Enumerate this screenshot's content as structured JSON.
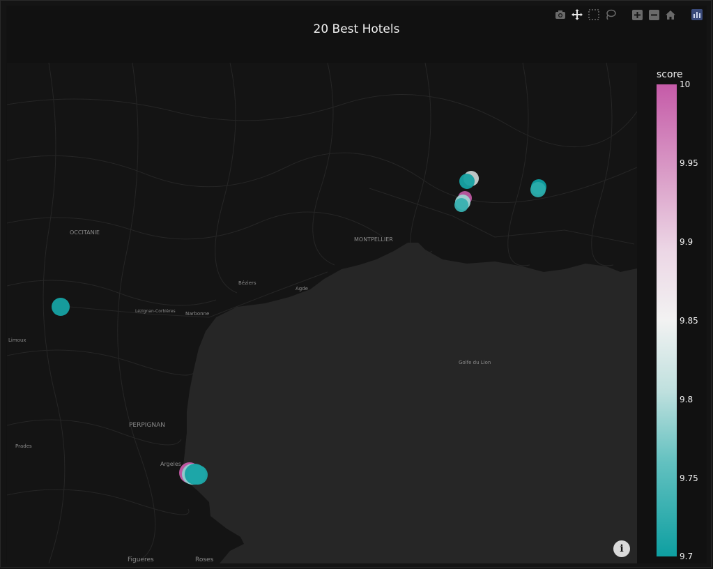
{
  "title": "20 Best Hotels",
  "modebar": [
    {
      "name": "camera-icon",
      "label": "Download plot as a png"
    },
    {
      "name": "pan-icon",
      "label": "Pan"
    },
    {
      "name": "box-select-icon",
      "label": "Box Select"
    },
    {
      "name": "lasso-select-icon",
      "label": "Lasso Select"
    },
    {
      "name": "zoom-in-icon",
      "label": "Zoom in"
    },
    {
      "name": "zoom-out-icon",
      "label": "Zoom out"
    },
    {
      "name": "reset-view-icon",
      "label": "Reset view"
    },
    {
      "name": "plotly-logo-icon",
      "label": "Produced with Plotly"
    }
  ],
  "colorbar": {
    "title": "score",
    "ticks": [
      "10",
      "9.95",
      "9.9",
      "9.85",
      "9.8",
      "9.75",
      "9.7"
    ],
    "colors": [
      "#c55ba8",
      "#f2f2f2",
      "#0e9fa1"
    ]
  },
  "map_labels": {
    "occitanie": "OCCITANIE",
    "montpellier": "MONTPELLIER",
    "perpignan": "PERPIGNAN",
    "figueres": "Figueres",
    "roses": "Roses",
    "argeles": "Argeles",
    "prades": "Prades",
    "limoux": "Limoux",
    "narbonne": "Narbonne",
    "beziers": "Béziers",
    "agde": "Agde",
    "lezignan": "Lézignan-Corbières",
    "golfe": "Golfe du Lion"
  },
  "info_glyph": "i"
}
